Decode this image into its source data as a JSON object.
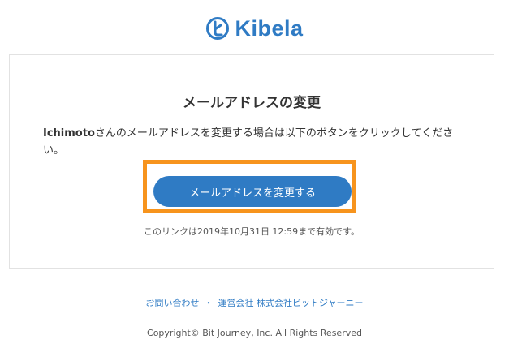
{
  "brand": {
    "name": "Kibela",
    "color": "#2f7bc4",
    "logo_icon": "kibela-logo-icon"
  },
  "email": {
    "title": "メールアドレスの変更",
    "username": "Ichimoto",
    "message": "さんのメールアドレスを変更する場合は以下のボタンをクリックしてください。",
    "button_label": "メールアドレスを変更する",
    "expiry_note": "このリンクは2019年10月31日 12:59まで有効です。",
    "highlight_color": "#f7941d"
  },
  "footer": {
    "contact_label": "お問い合わせ",
    "separator": "・",
    "company_label": "運営会社 株式会社ビットジャーニー",
    "copyright": "Copyright© Bit Journey, Inc. All Rights Reserved"
  }
}
